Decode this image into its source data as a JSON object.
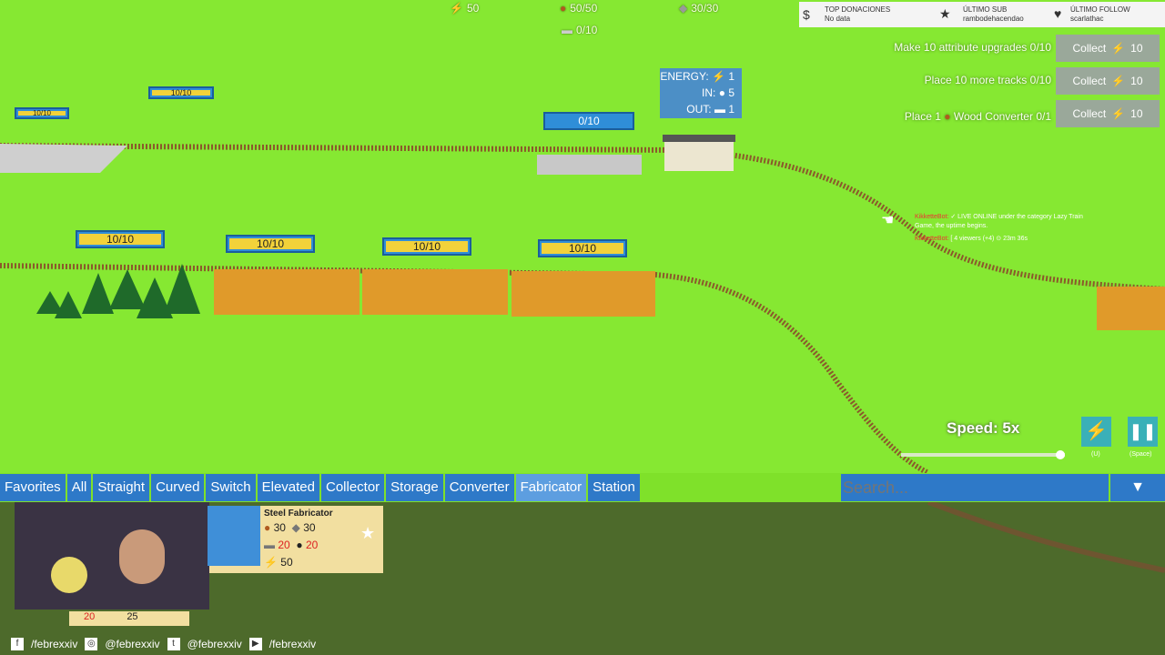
{
  "resources": {
    "energy": "50",
    "wood": "50/50",
    "stone": "30/30",
    "steel": "0/10"
  },
  "station_panel": {
    "energy_label": "ENERGY:",
    "energy_value": "1",
    "in_label": "IN:",
    "in_value": "5",
    "out_label": "OUT:",
    "out_value": "1"
  },
  "station_bar": "0/10",
  "top_left_bars": [
    "10/10",
    "10/10"
  ],
  "collectors": [
    "10/10",
    "10/10",
    "10/10",
    "10/10"
  ],
  "quests": [
    {
      "text": "Make 10 attribute upgrades 0/10",
      "button": "Collect",
      "reward": "10"
    },
    {
      "text": "Place 10 more tracks 0/10",
      "button": "Collect",
      "reward": "10"
    },
    {
      "text_before": "Place 1",
      "text_after": "Wood Converter 0/1",
      "button": "Collect",
      "reward": "10"
    }
  ],
  "stream": {
    "top_donations_label": "TOP DONACIONES",
    "top_donations_value": "No data",
    "last_sub_label": "ÚLTIMO SUB",
    "last_sub_value": "rambodehacendao",
    "last_follow_label": "ÚLTIMO FOLLOW",
    "last_follow_value": "scarlathac",
    "chat": [
      {
        "user": "KikketteBot:",
        "msg": "✓ LIVE ONLINE under the category Lazy Train Game, the uptime begins."
      },
      {
        "user": "KikketteBot:",
        "msg": "[ 4 viewers (+4) ⊙ 23m 36s"
      }
    ],
    "social": [
      "/febrexxiv",
      "@febrexxiv",
      "@febrexxiv",
      "/febrexxiv"
    ]
  },
  "speed": {
    "label": "Speed: 5x",
    "energy_key": "(U)",
    "pause_key": "(Space)"
  },
  "tabs": [
    "Favorites",
    "All",
    "Straight",
    "Curved",
    "Switch",
    "Elevated",
    "Collector",
    "Storage",
    "Converter",
    "Fabricator",
    "Station"
  ],
  "active_tab": "Fabricator",
  "search": {
    "placeholder": "Search..."
  },
  "card": {
    "title": "Steel Fabricator",
    "wood": "30",
    "stone": "30",
    "steel_in": "20",
    "coal": "20",
    "energy": "50"
  },
  "card2": {
    "a": "20",
    "b": "25"
  },
  "colors": {
    "grass": "#86e832",
    "tab": "#2e79c8",
    "tab_active": "#5d9ee0",
    "bar_fill": "#f2d23a",
    "bar_border": "#2f8ed8"
  }
}
